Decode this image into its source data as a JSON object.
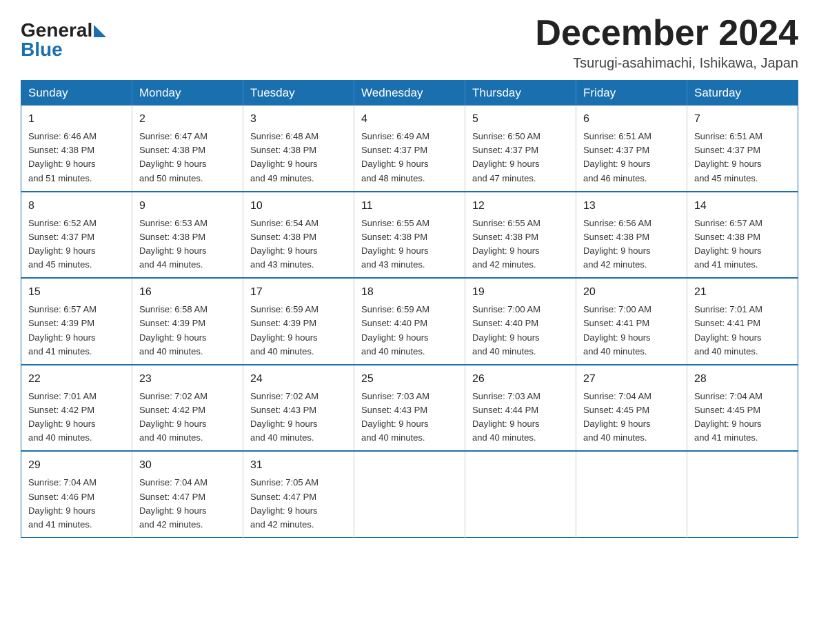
{
  "logo": {
    "text_general": "General",
    "text_blue": "Blue"
  },
  "header": {
    "title": "December 2024",
    "subtitle": "Tsurugi-asahimachi, Ishikawa, Japan"
  },
  "days_of_week": [
    "Sunday",
    "Monday",
    "Tuesday",
    "Wednesday",
    "Thursday",
    "Friday",
    "Saturday"
  ],
  "weeks": [
    [
      {
        "day": "1",
        "sunrise": "6:46 AM",
        "sunset": "4:38 PM",
        "daylight": "9 hours and 51 minutes."
      },
      {
        "day": "2",
        "sunrise": "6:47 AM",
        "sunset": "4:38 PM",
        "daylight": "9 hours and 50 minutes."
      },
      {
        "day": "3",
        "sunrise": "6:48 AM",
        "sunset": "4:38 PM",
        "daylight": "9 hours and 49 minutes."
      },
      {
        "day": "4",
        "sunrise": "6:49 AM",
        "sunset": "4:37 PM",
        "daylight": "9 hours and 48 minutes."
      },
      {
        "day": "5",
        "sunrise": "6:50 AM",
        "sunset": "4:37 PM",
        "daylight": "9 hours and 47 minutes."
      },
      {
        "day": "6",
        "sunrise": "6:51 AM",
        "sunset": "4:37 PM",
        "daylight": "9 hours and 46 minutes."
      },
      {
        "day": "7",
        "sunrise": "6:51 AM",
        "sunset": "4:37 PM",
        "daylight": "9 hours and 45 minutes."
      }
    ],
    [
      {
        "day": "8",
        "sunrise": "6:52 AM",
        "sunset": "4:37 PM",
        "daylight": "9 hours and 45 minutes."
      },
      {
        "day": "9",
        "sunrise": "6:53 AM",
        "sunset": "4:38 PM",
        "daylight": "9 hours and 44 minutes."
      },
      {
        "day": "10",
        "sunrise": "6:54 AM",
        "sunset": "4:38 PM",
        "daylight": "9 hours and 43 minutes."
      },
      {
        "day": "11",
        "sunrise": "6:55 AM",
        "sunset": "4:38 PM",
        "daylight": "9 hours and 43 minutes."
      },
      {
        "day": "12",
        "sunrise": "6:55 AM",
        "sunset": "4:38 PM",
        "daylight": "9 hours and 42 minutes."
      },
      {
        "day": "13",
        "sunrise": "6:56 AM",
        "sunset": "4:38 PM",
        "daylight": "9 hours and 42 minutes."
      },
      {
        "day": "14",
        "sunrise": "6:57 AM",
        "sunset": "4:38 PM",
        "daylight": "9 hours and 41 minutes."
      }
    ],
    [
      {
        "day": "15",
        "sunrise": "6:57 AM",
        "sunset": "4:39 PM",
        "daylight": "9 hours and 41 minutes."
      },
      {
        "day": "16",
        "sunrise": "6:58 AM",
        "sunset": "4:39 PM",
        "daylight": "9 hours and 40 minutes."
      },
      {
        "day": "17",
        "sunrise": "6:59 AM",
        "sunset": "4:39 PM",
        "daylight": "9 hours and 40 minutes."
      },
      {
        "day": "18",
        "sunrise": "6:59 AM",
        "sunset": "4:40 PM",
        "daylight": "9 hours and 40 minutes."
      },
      {
        "day": "19",
        "sunrise": "7:00 AM",
        "sunset": "4:40 PM",
        "daylight": "9 hours and 40 minutes."
      },
      {
        "day": "20",
        "sunrise": "7:00 AM",
        "sunset": "4:41 PM",
        "daylight": "9 hours and 40 minutes."
      },
      {
        "day": "21",
        "sunrise": "7:01 AM",
        "sunset": "4:41 PM",
        "daylight": "9 hours and 40 minutes."
      }
    ],
    [
      {
        "day": "22",
        "sunrise": "7:01 AM",
        "sunset": "4:42 PM",
        "daylight": "9 hours and 40 minutes."
      },
      {
        "day": "23",
        "sunrise": "7:02 AM",
        "sunset": "4:42 PM",
        "daylight": "9 hours and 40 minutes."
      },
      {
        "day": "24",
        "sunrise": "7:02 AM",
        "sunset": "4:43 PM",
        "daylight": "9 hours and 40 minutes."
      },
      {
        "day": "25",
        "sunrise": "7:03 AM",
        "sunset": "4:43 PM",
        "daylight": "9 hours and 40 minutes."
      },
      {
        "day": "26",
        "sunrise": "7:03 AM",
        "sunset": "4:44 PM",
        "daylight": "9 hours and 40 minutes."
      },
      {
        "day": "27",
        "sunrise": "7:04 AM",
        "sunset": "4:45 PM",
        "daylight": "9 hours and 40 minutes."
      },
      {
        "day": "28",
        "sunrise": "7:04 AM",
        "sunset": "4:45 PM",
        "daylight": "9 hours and 41 minutes."
      }
    ],
    [
      {
        "day": "29",
        "sunrise": "7:04 AM",
        "sunset": "4:46 PM",
        "daylight": "9 hours and 41 minutes."
      },
      {
        "day": "30",
        "sunrise": "7:04 AM",
        "sunset": "4:47 PM",
        "daylight": "9 hours and 42 minutes."
      },
      {
        "day": "31",
        "sunrise": "7:05 AM",
        "sunset": "4:47 PM",
        "daylight": "9 hours and 42 minutes."
      },
      null,
      null,
      null,
      null
    ]
  ],
  "labels": {
    "sunrise": "Sunrise:",
    "sunset": "Sunset:",
    "daylight": "Daylight:"
  }
}
